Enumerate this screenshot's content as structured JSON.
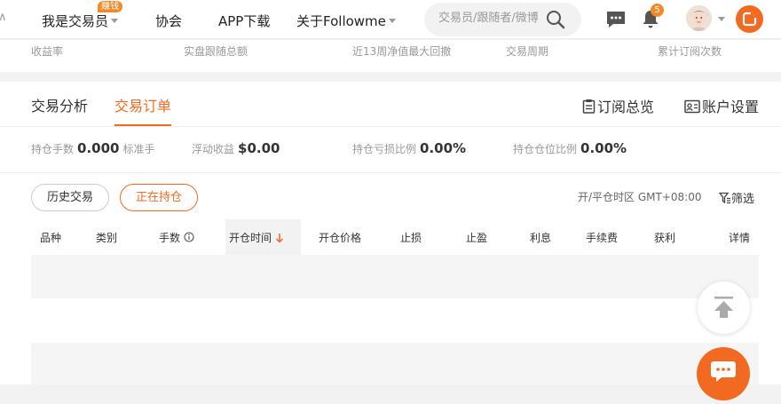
{
  "nav": {
    "left_partial": "∧",
    "trader": "我是交易员",
    "trader_tag": "赚钱",
    "association": "协会",
    "app_download": "APP下载",
    "about": "关于Followme",
    "search_placeholder": "交易员/跟随者/微博",
    "notification_count": "5"
  },
  "stats_strip": {
    "labels": [
      "收益率",
      "实盘跟随总额",
      "近13周净值最大回撤",
      "交易周期",
      "累计订阅次数"
    ]
  },
  "tabs": {
    "analysis": "交易分析",
    "orders": "交易订单"
  },
  "tools": {
    "subscription_overview": "订阅总览",
    "account_settings": "账户设置"
  },
  "summary": {
    "lots_label": "持仓手数",
    "lots_value": "0.000",
    "lots_unit": "标准手",
    "floating_label": "浮动收益",
    "floating_value": "$0.00",
    "pl_ratio_label": "持仓亏损比例",
    "pl_ratio_value": "0.00%",
    "position_ratio_label": "持仓仓位比例",
    "position_ratio_value": "0.00%"
  },
  "filters": {
    "history": "历史交易",
    "current": "正在持仓",
    "timezone": "开/平仓时区 GMT+08:00",
    "filter": "筛选"
  },
  "table": {
    "columns": [
      "品种",
      "类别",
      "手数",
      "开仓时间",
      "开仓价格",
      "止损",
      "止盈",
      "利息",
      "手续费",
      "获利",
      "详情"
    ]
  },
  "colors": {
    "accent": "#f26a21",
    "tag": "#f08a2a"
  }
}
